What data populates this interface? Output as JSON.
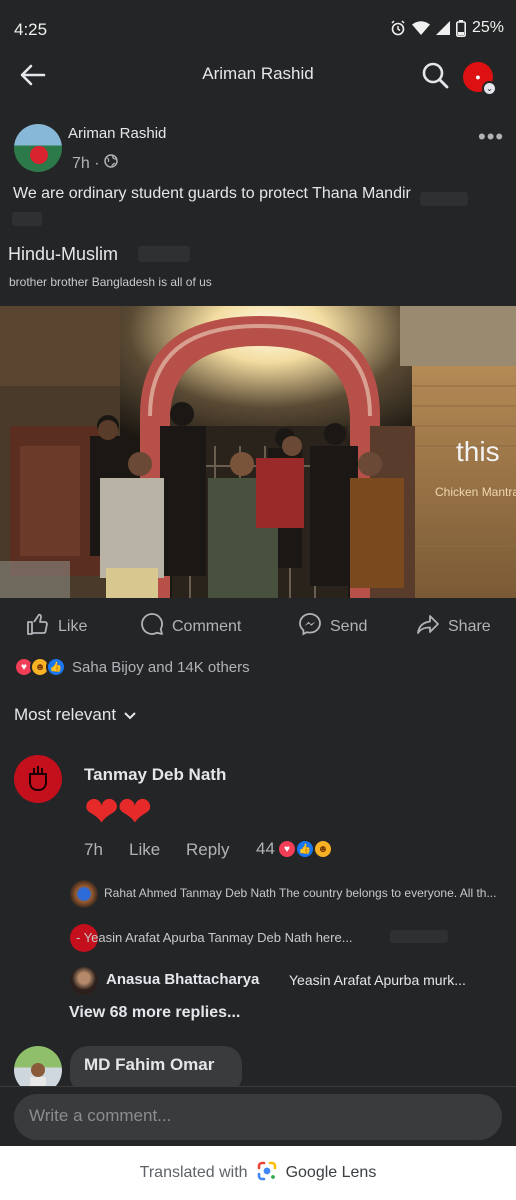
{
  "status": {
    "time": "4:25",
    "battery": "25%"
  },
  "topbar": {
    "title": "Ariman Rashid"
  },
  "post": {
    "author": "Ariman Rashid",
    "time": "7h ·",
    "text_line1": "We are ordinary student guards to protect Thana Mandir",
    "text_line2": "Hindu-Muslim",
    "text_line3": "brother brother Bangladesh is all of us",
    "photo_overlay_1": "this",
    "photo_overlay_2": "Chicken Mantra"
  },
  "actions": {
    "like": "Like",
    "comment": "Comment",
    "send": "Send",
    "share": "Share"
  },
  "reactions": {
    "text": "Saha Bijoy and 14K others"
  },
  "sort": {
    "label": "Most relevant"
  },
  "comment1": {
    "name": "Tanmay Deb Nath",
    "body": "❤❤",
    "time": "7h",
    "like": "Like",
    "reply": "Reply",
    "count": "44"
  },
  "replies": [
    {
      "text": "Rahat Ahmed Tanmay Deb Nath The country belongs to everyone. All th..."
    },
    {
      "text": "- Yeasin Arafat Apurba Tanmay Deb Nath here..."
    },
    {
      "name": "Anasua Bhattacharya",
      "text": "Yeasin Arafat Apurba murk..."
    }
  ],
  "view_more": "View 68 more replies...",
  "comment2": {
    "name": "MD Fahim Omar"
  },
  "composer": {
    "placeholder": "Write a comment..."
  },
  "footer": {
    "prefix": "Translated with",
    "brand": "Google Lens"
  },
  "colors": {
    "background": "#242526",
    "love": "#f33e58",
    "like": "#1877f2",
    "care": "#f7b125"
  }
}
